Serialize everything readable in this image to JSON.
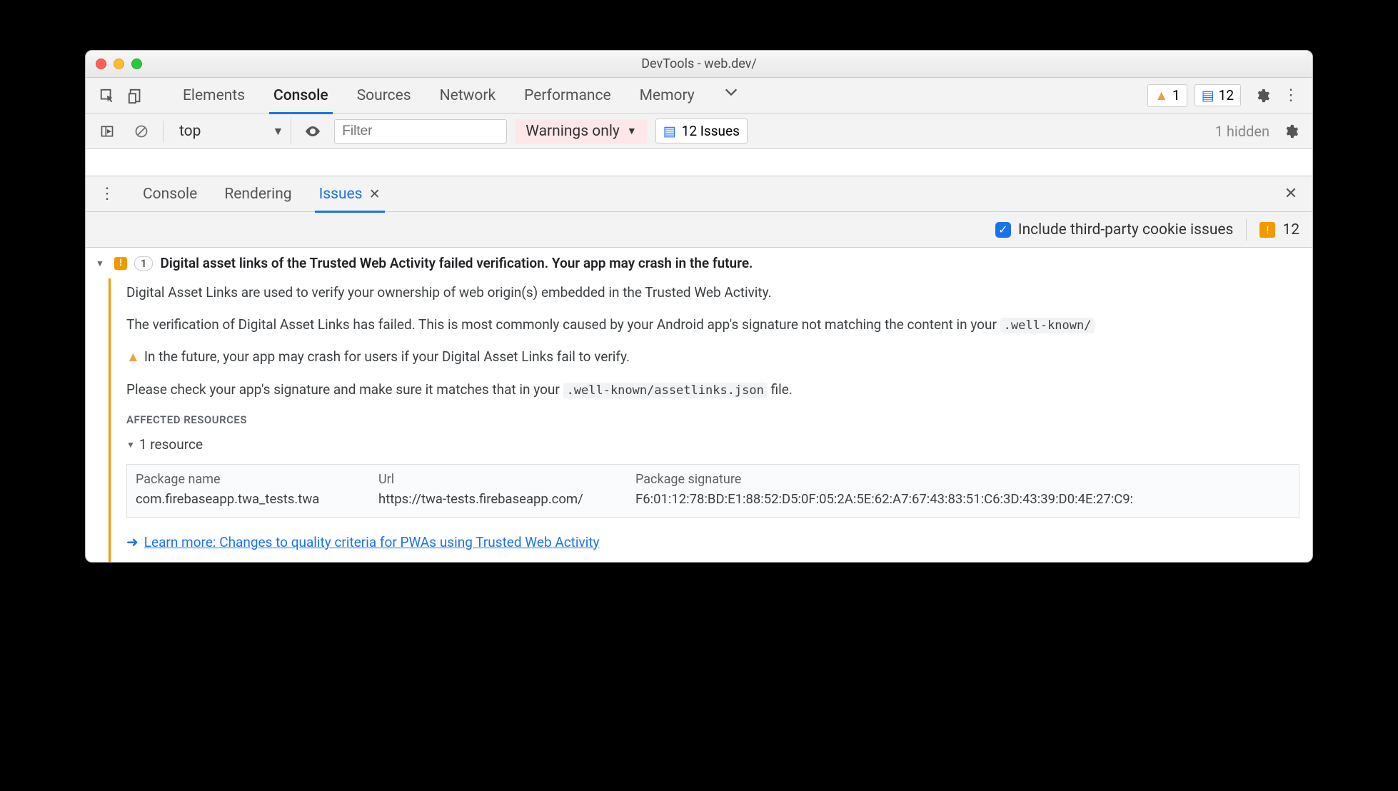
{
  "window": {
    "title": "DevTools - web.dev/"
  },
  "tabs": {
    "items": [
      "Elements",
      "Console",
      "Sources",
      "Network",
      "Performance",
      "Memory"
    ],
    "active": "Console"
  },
  "badges": {
    "warnings": "1",
    "issues_top": "12"
  },
  "console_toolbar": {
    "context": "top",
    "filter_placeholder": "Filter",
    "level": "Warnings only",
    "issues_button": "12 Issues",
    "hidden": "1 hidden"
  },
  "drawer_tabs": {
    "items": [
      "Console",
      "Rendering",
      "Issues"
    ],
    "active": "Issues"
  },
  "issues_bar": {
    "checkbox_label": "Include third-party cookie issues",
    "count": "12"
  },
  "issue": {
    "count": "1",
    "title": "Digital asset links of the Trusted Web Activity failed verification. Your app may crash in the future.",
    "p1": "Digital Asset Links are used to verify your ownership of web origin(s) embedded in the Trusted Web Activity.",
    "p2a": "The verification of Digital Asset Links has failed. This is most commonly caused by your Android app's signature not matching the content in your ",
    "p2code": ".well-known/",
    "p3": "In the future, your app may crash for users if your Digital Asset Links fail to verify.",
    "p4a": "Please check your app's signature and make sure it matches that in your ",
    "p4code": ".well-known/assetlinks.json",
    "p4b": " file.",
    "affected_label": "Affected Resources",
    "resource_count": "1 resource",
    "table": {
      "headers": {
        "c1": "Package name",
        "c2": "Url",
        "c3": "Package signature"
      },
      "row": {
        "c1": "com.firebaseapp.twa_tests.twa",
        "c2": "https://twa-tests.firebaseapp.com/",
        "c3": "F6:01:12:78:BD:E1:88:52:D5:0F:05:2A:5E:62:A7:67:43:83:51:C6:3D:43:39:D0:4E:27:C9:"
      }
    },
    "learn_more": "Learn more: Changes to quality criteria for PWAs using Trusted Web Activity"
  }
}
